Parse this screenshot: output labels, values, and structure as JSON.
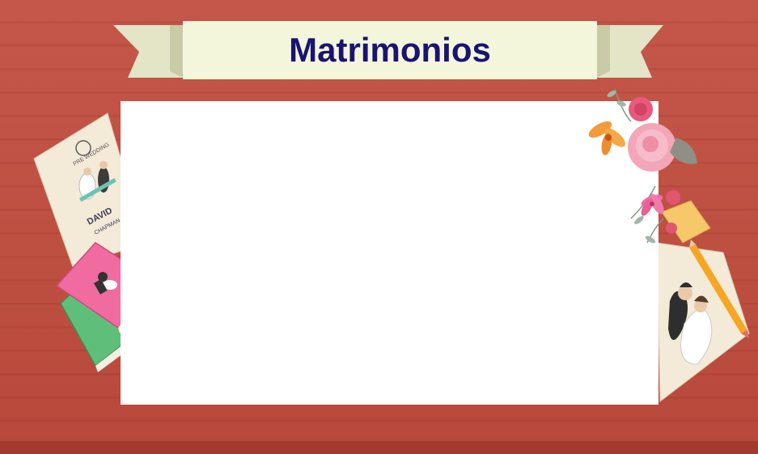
{
  "title": "Matrimonios",
  "invitation": {
    "small_heading": "PRE WEDDING",
    "name_first": "DAVID",
    "name_last": "CHAPMAN"
  },
  "icons": [
    "ribbon-banner-icon",
    "wedding-invitation-card-icon",
    "wedding-book-icon",
    "flower-bouquet-icon",
    "pencil-icon",
    "sticky-note-icon",
    "wedding-couple-photo-icon"
  ],
  "colors": {
    "wood": "#bd4f41",
    "ribbon": "#f4f6dc",
    "title": "#1a1470",
    "board": "#ffffff"
  }
}
